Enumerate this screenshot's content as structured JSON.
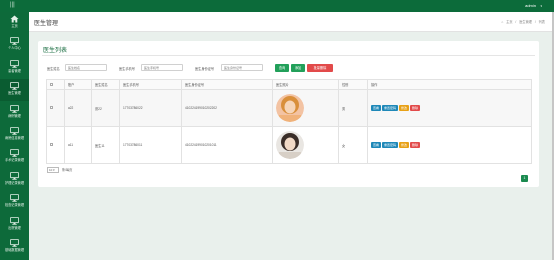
{
  "header": {
    "menu_icon": "menu-icon",
    "user": "admin",
    "user_caret": "▾"
  },
  "sidebar": {
    "items": [
      {
        "label": "主页",
        "icon": "home-icon"
      },
      {
        "label": "个人中心",
        "icon": "monitor-icon"
      },
      {
        "label": "患者管理",
        "icon": "monitor-icon"
      },
      {
        "label": "医生管理",
        "icon": "monitor-icon"
      },
      {
        "label": "病例管理",
        "icon": "monitor-icon"
      },
      {
        "label": "病房信息管理",
        "icon": "monitor-icon"
      },
      {
        "label": "手术记录管理",
        "icon": "monitor-icon"
      },
      {
        "label": "护理记录管理",
        "icon": "monitor-icon"
      },
      {
        "label": "检查记录管理",
        "icon": "monitor-icon"
      },
      {
        "label": "出院管理",
        "icon": "monitor-icon"
      },
      {
        "label": "基础数据管理",
        "icon": "monitor-icon"
      }
    ],
    "active_index": 3
  },
  "page": {
    "title": "医生管理",
    "breadcrumb": {
      "home": "主页",
      "sep": "/",
      "b2": "医生管理",
      "b3": "列表"
    }
  },
  "card": {
    "title": "医生列表"
  },
  "filters": {
    "f1": {
      "label": "医生姓名",
      "placeholder": "医生姓名"
    },
    "f2": {
      "label": "医生手机号",
      "placeholder": "医生手机号"
    },
    "f3": {
      "label": "医生身份证号",
      "placeholder": "医生身份证号"
    },
    "search": "查询",
    "add": "添加",
    "batch_delete": "批量删除"
  },
  "table": {
    "headers": [
      "账户",
      "医生姓名",
      "医生手机号",
      "医生身份证号",
      "医生照片",
      "性别",
      "操作"
    ],
    "rows": [
      {
        "account": "a22",
        "name": "张22",
        "phone": "17703786022",
        "idcard": "410224199010202202",
        "photo": "avatar-portrait-1",
        "gender": "男"
      },
      {
        "account": "a11",
        "name": "医生11",
        "phone": "17703786011",
        "idcard": "410224199010201011",
        "photo": "avatar-portrait-2",
        "gender": "女"
      }
    ],
    "ops": {
      "view": "查看",
      "reset": "重置密码",
      "edit": "修改",
      "delete": "删除"
    }
  },
  "pagination": {
    "page_size": "10",
    "suffix": "条/每页",
    "current": "1"
  },
  "colors": {
    "brand": "#0d6a3a",
    "accent": "#22a05a",
    "danger": "#e24a4a",
    "info": "#1e88b8",
    "warn": "#e8a117"
  }
}
